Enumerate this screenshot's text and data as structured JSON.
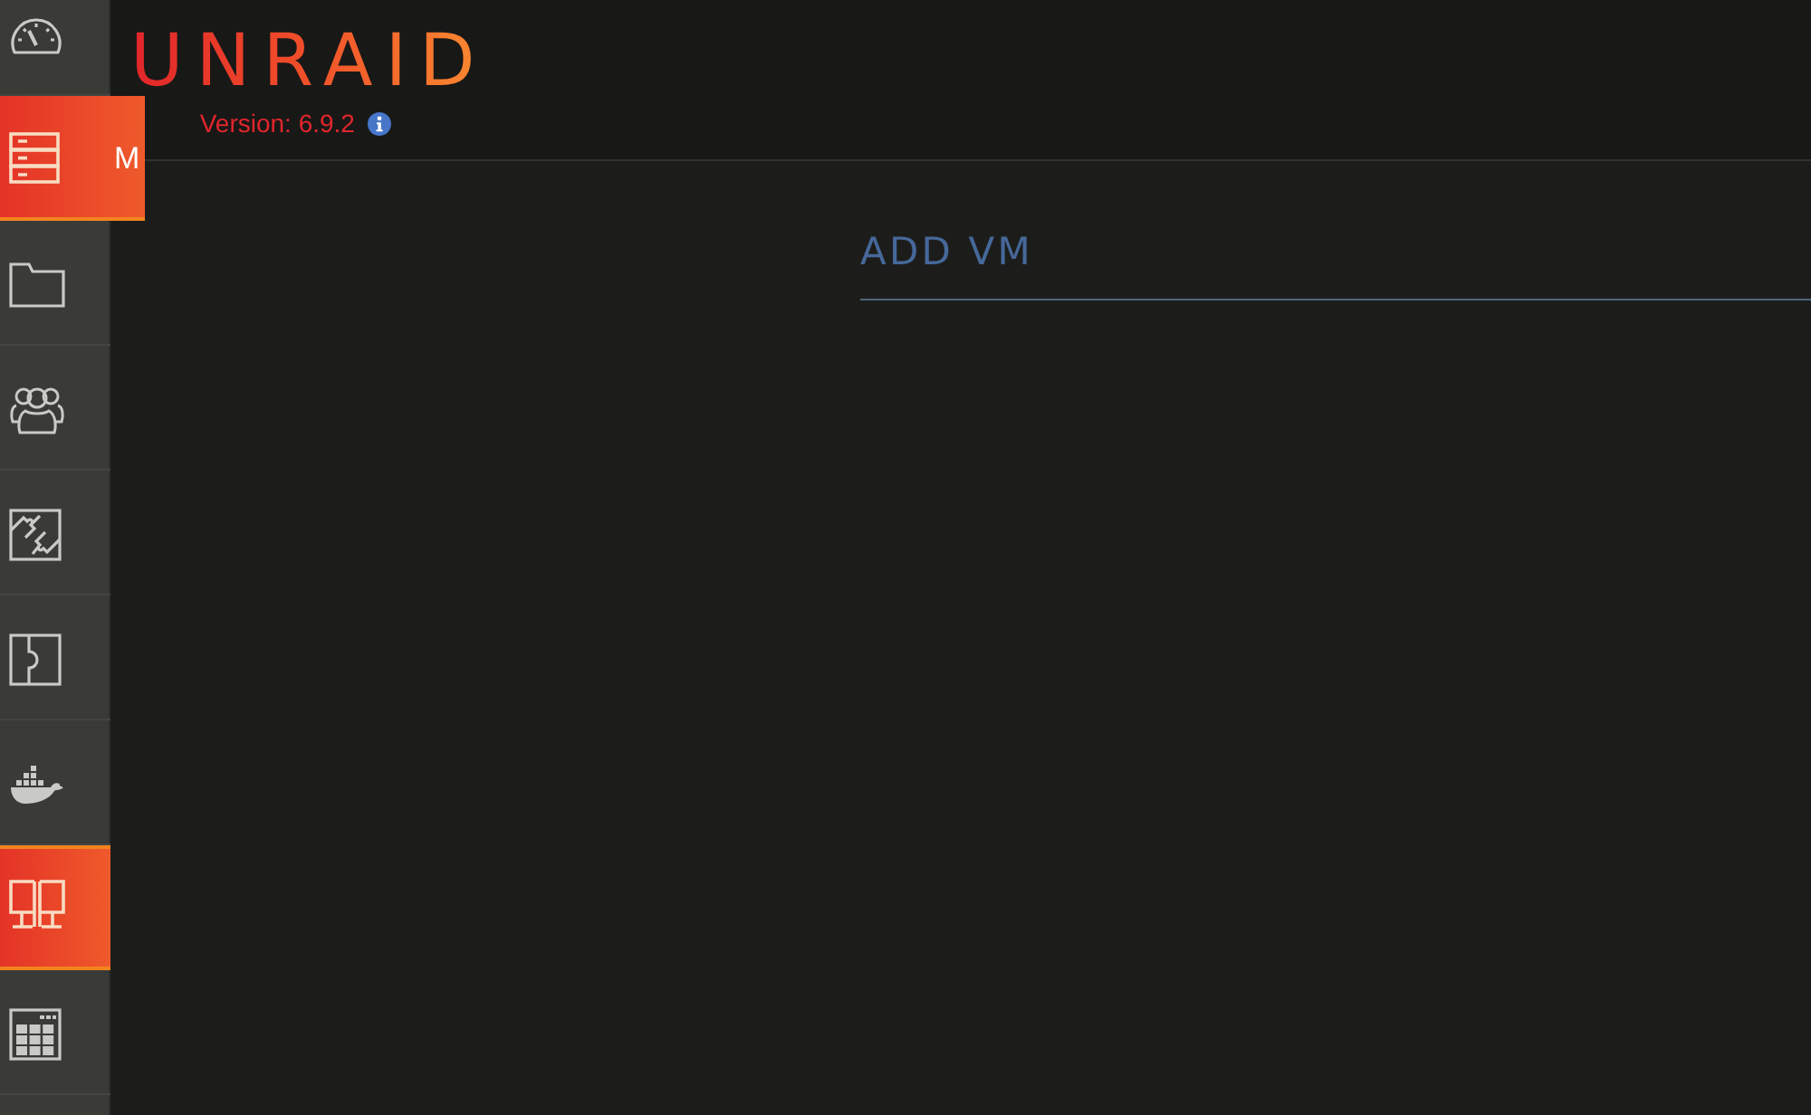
{
  "sidebar": {
    "items": [
      {
        "selected": false,
        "hovered": false
      },
      {
        "selected": false,
        "hovered": true,
        "label": "M"
      },
      {
        "selected": false,
        "hovered": false
      },
      {
        "selected": false,
        "hovered": false
      },
      {
        "selected": false,
        "hovered": false
      },
      {
        "selected": false,
        "hovered": false
      },
      {
        "selected": false,
        "hovered": false
      },
      {
        "selected": true,
        "hovered": false
      },
      {
        "selected": false,
        "hovered": false
      }
    ]
  },
  "header": {
    "logo": "UNRAID",
    "version": "Version: 6.9.2"
  },
  "page": {
    "title": "ADD VM"
  }
}
